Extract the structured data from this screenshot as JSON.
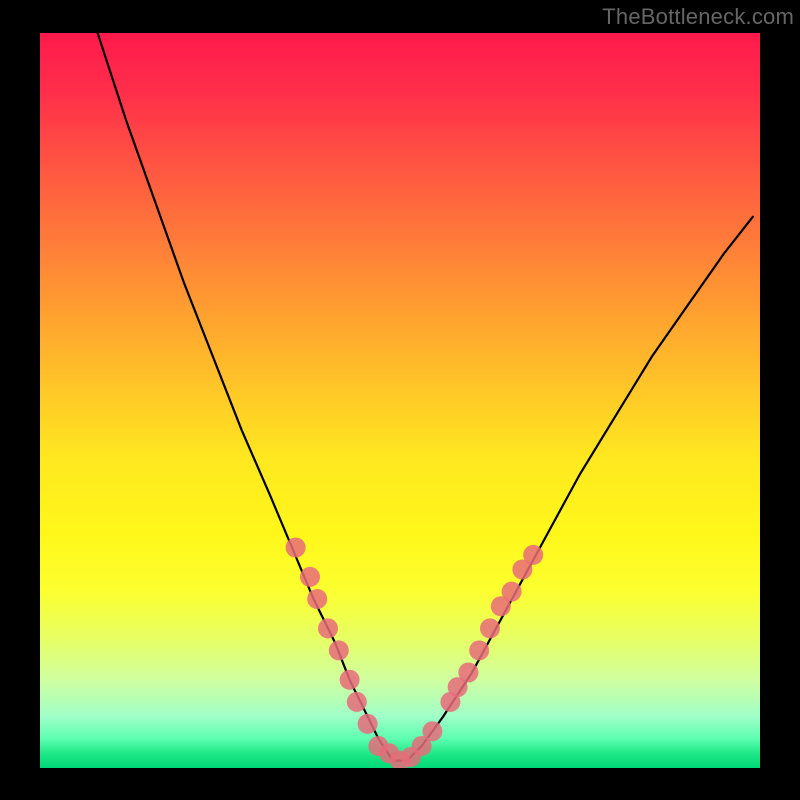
{
  "watermark": "TheBottleneck.com",
  "chart_data": {
    "type": "line",
    "title": "",
    "xlabel": "",
    "ylabel": "",
    "xlim": [
      0,
      100
    ],
    "ylim": [
      0,
      100
    ],
    "grid": false,
    "legend": false,
    "series": [
      {
        "name": "bottleneck-curve",
        "color": "#000000",
        "x": [
          8,
          12,
          16,
          20,
          24,
          28,
          32,
          35,
          38,
          41,
          43,
          45,
          47,
          49,
          51,
          53,
          56,
          60,
          65,
          70,
          75,
          80,
          85,
          90,
          95,
          99
        ],
        "y": [
          100,
          88,
          77,
          66,
          56,
          46,
          37,
          30,
          23,
          17,
          12,
          8,
          4,
          1,
          1,
          3,
          7,
          13,
          22,
          31,
          40,
          48,
          56,
          63,
          70,
          75
        ]
      }
    ],
    "scatter_points": {
      "name": "highlighted-points",
      "color": "#e86b7a",
      "radius": 10,
      "points": [
        {
          "x": 35.5,
          "y": 30
        },
        {
          "x": 37.5,
          "y": 26
        },
        {
          "x": 38.5,
          "y": 23
        },
        {
          "x": 40.0,
          "y": 19
        },
        {
          "x": 41.5,
          "y": 16
        },
        {
          "x": 43.0,
          "y": 12
        },
        {
          "x": 44.0,
          "y": 9
        },
        {
          "x": 45.5,
          "y": 6
        },
        {
          "x": 47.0,
          "y": 3
        },
        {
          "x": 48.5,
          "y": 2
        },
        {
          "x": 50.0,
          "y": 1
        },
        {
          "x": 51.5,
          "y": 1.5
        },
        {
          "x": 53.0,
          "y": 3
        },
        {
          "x": 54.5,
          "y": 5
        },
        {
          "x": 57.0,
          "y": 9
        },
        {
          "x": 58.0,
          "y": 11
        },
        {
          "x": 59.5,
          "y": 13
        },
        {
          "x": 61.0,
          "y": 16
        },
        {
          "x": 62.5,
          "y": 19
        },
        {
          "x": 64.0,
          "y": 22
        },
        {
          "x": 65.5,
          "y": 24
        },
        {
          "x": 67.0,
          "y": 27
        },
        {
          "x": 68.5,
          "y": 29
        }
      ]
    }
  }
}
